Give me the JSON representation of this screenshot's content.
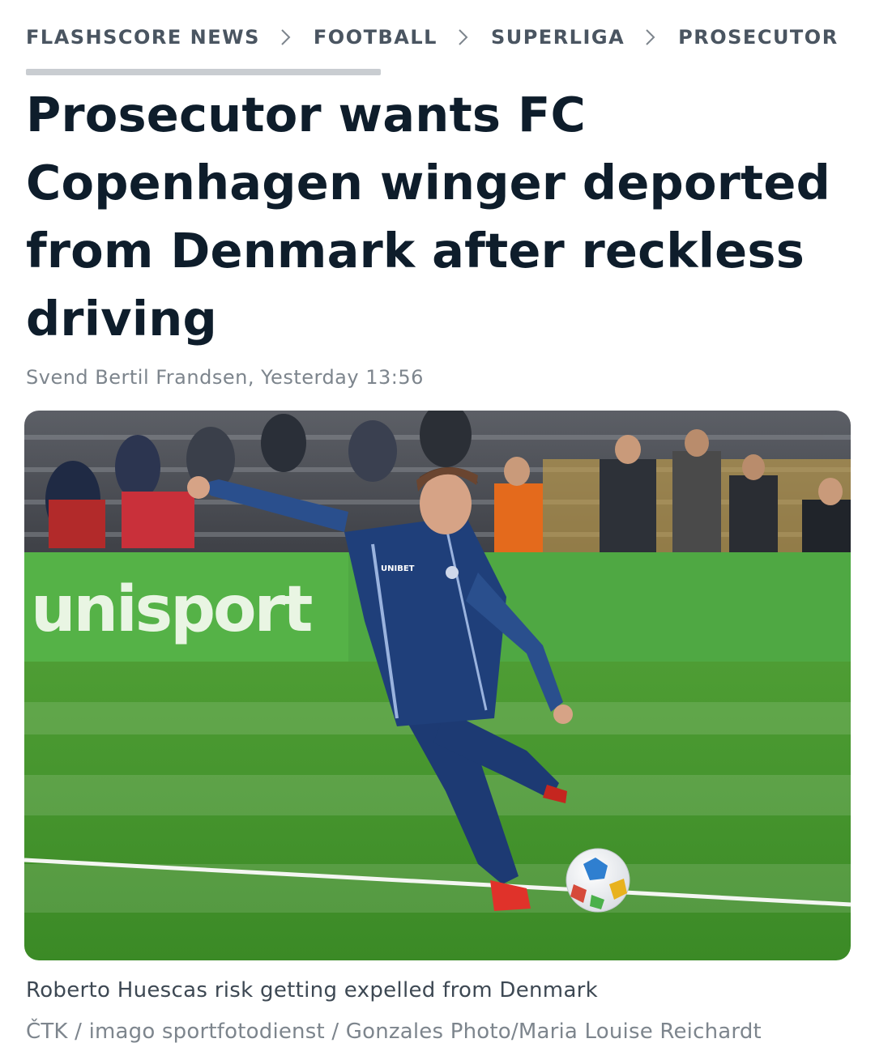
{
  "breadcrumb": {
    "items": [
      {
        "label": "FLASHSCORE NEWS"
      },
      {
        "label": "FOOTBALL"
      },
      {
        "label": "SUPERLIGA"
      },
      {
        "label": "PROSECUTOR"
      }
    ]
  },
  "article": {
    "headline_lines": [
      "Prosecutor wants FC",
      "Copenhagen winger deported",
      "from Denmark after reckless",
      "driving"
    ],
    "author": "Svend Bertil Frandsen",
    "timestamp": "Yesterday 13:56",
    "image": {
      "description_icon": "football-player-photo",
      "advertising_board_text": "unisport",
      "shirt_sponsor_text": "UNIBET"
    },
    "caption": "Roberto Huescas risk getting expelled from Denmark",
    "credit": "ČTK / imago sportfotodienst / Gonzales Photo/Maria Louise Reichardt"
  },
  "colors": {
    "headline": "#0e1d2b",
    "breadcrumb": "#4a5561",
    "muted": "#7d858d",
    "pitch_green": "#3f9a2e",
    "board_green": "#52b043",
    "kit_navy": "#1f3f7a"
  }
}
